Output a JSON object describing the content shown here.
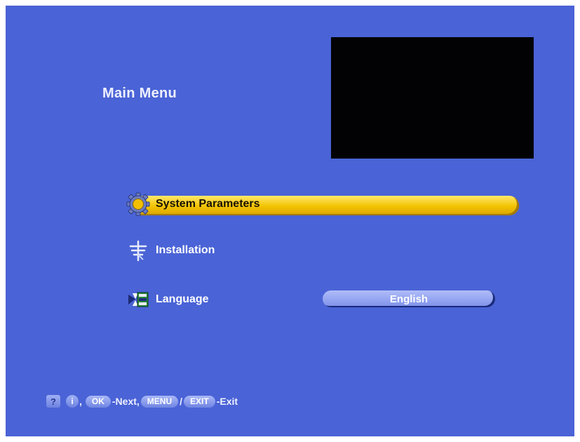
{
  "menu": {
    "title": "Main Menu",
    "items": [
      {
        "label": "System Parameters",
        "icon": "gear-icon",
        "selected": true
      },
      {
        "label": "Installation",
        "icon": "antenna-icon",
        "selected": false
      },
      {
        "label": "Language",
        "icon": "language-icon",
        "selected": false,
        "value": "English"
      }
    ]
  },
  "footer": {
    "help_key": "?",
    "info_key": "i",
    "sep1": ",",
    "ok_key": "OK",
    "next_text": "-Next,",
    "menu_key": "MENU",
    "slash": "/",
    "exit_key": "EXIT",
    "exit_text": "-Exit"
  },
  "colors": {
    "background": "#4a63d6",
    "highlight": "#f2c200",
    "preview": "#020204"
  }
}
